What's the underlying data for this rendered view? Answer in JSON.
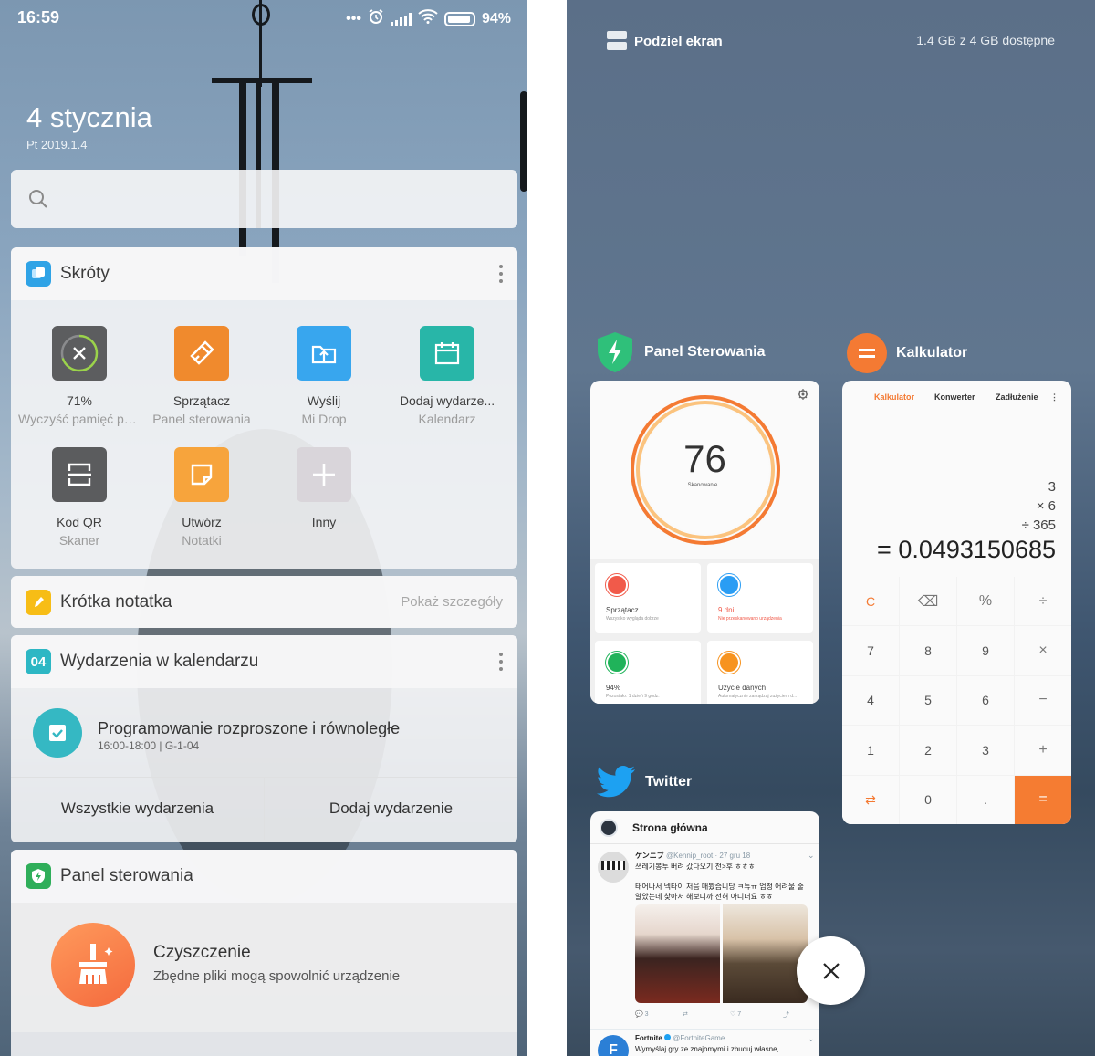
{
  "left": {
    "status": {
      "time": "16:59",
      "dots": "•••",
      "battery_text": "94%",
      "battery_level": 0.94
    },
    "date": {
      "big": "4 stycznia",
      "small": "Pt 2019.1.4"
    },
    "search": {
      "icon": "search-icon"
    },
    "shortcuts": {
      "title": "Skróty",
      "items": [
        {
          "l1": "71%",
          "l2": "Wyczyść pamięć po...",
          "icon": "clean-memory-icon",
          "color": "#5c5d5f"
        },
        {
          "l1": "Sprzątacz",
          "l2": "Panel sterowania",
          "icon": "broom-icon",
          "color": "#f08a2d"
        },
        {
          "l1": "Wyślij",
          "l2": "Mi Drop",
          "icon": "upload-icon",
          "color": "#38a6ee"
        },
        {
          "l1": "Dodaj wydarze...",
          "l2": "Kalendarz",
          "icon": "calendar-icon",
          "color": "#28b6a8"
        },
        {
          "l1": "Kod QR",
          "l2": "Skaner",
          "icon": "qr-scanner-icon",
          "color": "#5b5c5e"
        },
        {
          "l1": "Utwórz",
          "l2": "Notatki",
          "icon": "note-icon",
          "color": "#f7a43c"
        },
        {
          "l1": "Inny",
          "l2": "",
          "icon": "plus-icon",
          "color": "#d9d5da"
        }
      ]
    },
    "note": {
      "title": "Krótka notatka",
      "link": "Pokaż szczegóły"
    },
    "calendar": {
      "badge": "04",
      "title": "Wydarzenia w kalendarzu",
      "event": {
        "title": "Programowanie rozproszone i równoległe",
        "meta": "16:00-18:00  |  G-1-04"
      },
      "btn_all": "Wszystkie wydarzenia",
      "btn_add": "Dodaj wydarzenie"
    },
    "panel": {
      "title": "Panel sterowania",
      "clean_title": "Czyszczenie",
      "clean_sub": "Zbędne pliki mogą spowolnić urządzenie"
    }
  },
  "right": {
    "split_label": "Podziel ekran",
    "memory": "1.4 GB z 4 GB dostępne",
    "security": {
      "label": "Panel Sterowania",
      "score": "76",
      "scan_text": "Skanowanie...",
      "tiles": [
        {
          "t1": "Sprzątacz",
          "t2": "Wszystko wygląda dobrze",
          "color": "#f15a4a",
          "t1_color": "#444"
        },
        {
          "t1": "9 dni",
          "t2": "Nie przeskanowano urządzenia",
          "color": "#2a9df4",
          "t1_color": "#f15a4a"
        },
        {
          "t1": "94%",
          "t2": "Pozostało: 1 dzień 9 godz.",
          "color": "#20b35a",
          "t1_color": "#444"
        },
        {
          "t1": "Użycie danych",
          "t2": "Automatycznie zarządzaj zużyciem d...",
          "color": "#f7931e",
          "t1_color": "#444"
        }
      ]
    },
    "calculator": {
      "label": "Kalkulator",
      "tabs": [
        "Kalkulator",
        "Konwerter",
        "Zadłużenie"
      ],
      "history": [
        "3",
        "×  6",
        "÷  365"
      ],
      "result": "= 0.0493150685",
      "keys": [
        "C",
        "⌫",
        "%",
        "÷",
        "7",
        "8",
        "9",
        "×",
        "4",
        "5",
        "6",
        "−",
        "1",
        "2",
        "3",
        "+",
        "⇄",
        "0",
        ".",
        "="
      ]
    },
    "twitter": {
      "label": "Twitter",
      "header": "Strona główna",
      "tweet1": {
        "name": "ケンニブ",
        "meta": "@Kennip_root · 27 gru 18",
        "text1": "쓰레기봉투 버려 갔다오기 전>후 ㅎㅎㅎ",
        "text2": "태어나서 넥타이 처음 매봤습니당 ㅋ튜ㅠ 엄청 어려울 줄",
        "text3": "알았는데 찾아서 해보니까 전혀 아니더요 ㅎㅎ",
        "replies": "3",
        "likes": "7"
      },
      "tweet2": {
        "name": "Fortnite",
        "handle": "@FortniteGame",
        "text": "Wymyślaj gry ze znajomymi i zbuduj własne,"
      }
    }
  }
}
